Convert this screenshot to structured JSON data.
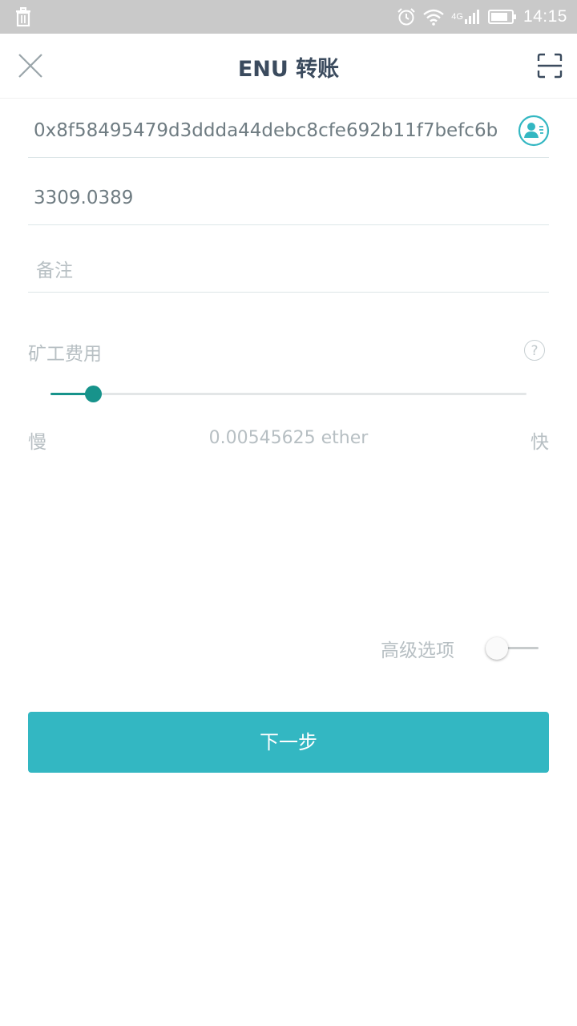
{
  "status_bar": {
    "time": "14:15",
    "network": "4G",
    "icons": [
      "trash-icon",
      "alarm-icon",
      "wifi-icon",
      "signal-icon",
      "battery-icon"
    ]
  },
  "header": {
    "title": "ENU 转账",
    "close_icon": "close-icon",
    "scan_icon": "scan-icon"
  },
  "form": {
    "address": {
      "value": "0x8f58495479d3ddda44debc8cfe692b11f7befc6b",
      "contact_icon": "contact-book-icon"
    },
    "amount": {
      "value": "3309.0389"
    },
    "memo": {
      "placeholder": "备注",
      "value": ""
    }
  },
  "fee": {
    "label": "矿工费用",
    "help_icon": "?",
    "slider_fraction": 0.09,
    "slow_label": "慢",
    "fast_label": "快",
    "amount_text": "0.00545625 ether"
  },
  "advanced": {
    "label": "高级选项",
    "enabled": false
  },
  "next_button": {
    "label": "下一步"
  },
  "colors": {
    "accent": "#17938b",
    "button": "#33b7c2",
    "title": "#3b4b5e",
    "muted": "#b7bfc3"
  }
}
